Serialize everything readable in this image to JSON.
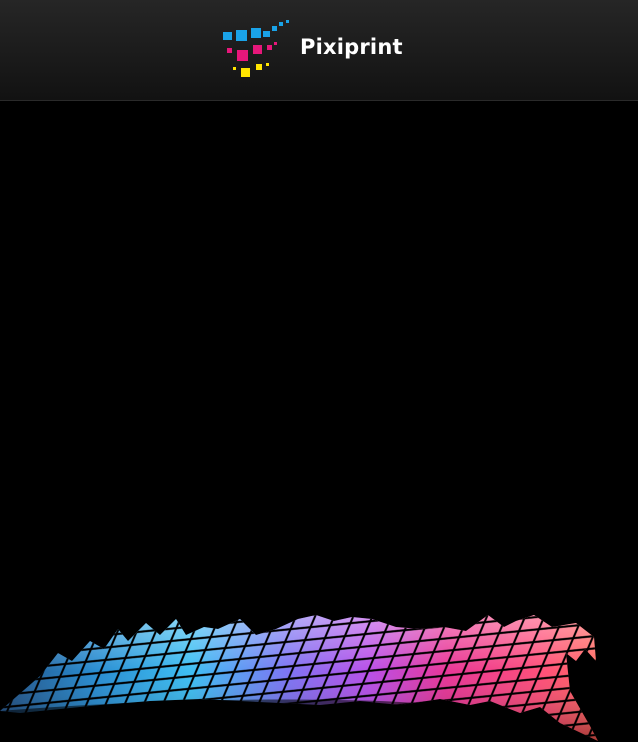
{
  "header": {
    "brand_name": "Pixiprint",
    "logo_icon": "pixiprint-pixel-logo-icon",
    "logo_colors": {
      "cyan": "#1aa3e8",
      "magenta": "#e6177a",
      "yellow": "#ffe500"
    },
    "background": "#1c1c1c"
  },
  "stage": {
    "background": "#000000",
    "graphic": "mosaic-wave-graphic",
    "gradient_colors": [
      "#0a5fb4",
      "#22b6f0",
      "#9b59ff",
      "#e0208c",
      "#ff4f5e",
      "#ff7a3a"
    ]
  }
}
